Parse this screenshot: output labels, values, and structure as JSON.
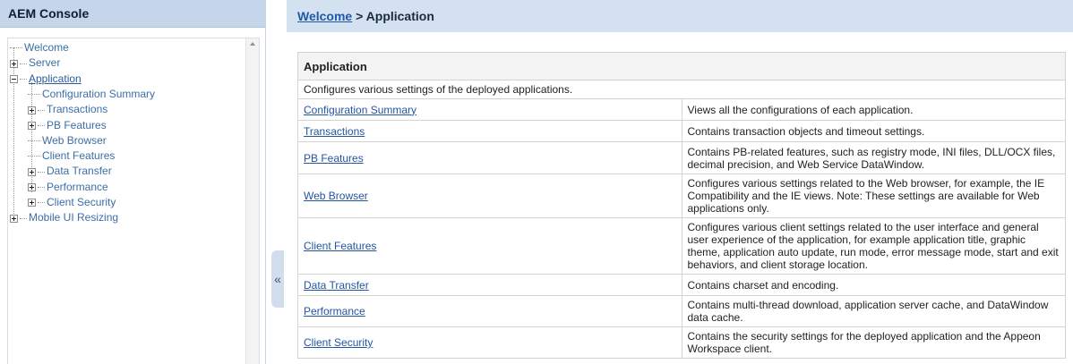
{
  "left_panel": {
    "title": "AEM Console",
    "tree": [
      {
        "label": "Welcome",
        "level": 0,
        "expander": "none",
        "is_link": false
      },
      {
        "label": "Server",
        "level": 0,
        "expander": "plus",
        "is_link": false
      },
      {
        "label": "Application",
        "level": 0,
        "expander": "minus",
        "is_link": true
      },
      {
        "label": "Configuration Summary",
        "level": 1,
        "expander": "none",
        "is_link": false
      },
      {
        "label": "Transactions",
        "level": 1,
        "expander": "plus",
        "is_link": false
      },
      {
        "label": "PB Features",
        "level": 1,
        "expander": "plus",
        "is_link": false
      },
      {
        "label": "Web Browser",
        "level": 1,
        "expander": "none",
        "is_link": false
      },
      {
        "label": "Client Features",
        "level": 1,
        "expander": "none",
        "is_link": false
      },
      {
        "label": "Data Transfer",
        "level": 1,
        "expander": "plus",
        "is_link": false
      },
      {
        "label": "Performance",
        "level": 1,
        "expander": "plus",
        "is_link": false
      },
      {
        "label": "Client Security",
        "level": 1,
        "expander": "plus",
        "is_link": false
      },
      {
        "label": "Mobile UI Resizing",
        "level": 0,
        "expander": "plus",
        "is_link": false
      }
    ]
  },
  "collapse_handle": {
    "glyph": "«"
  },
  "breadcrumb": {
    "link": "Welcome",
    "separator": ">",
    "current": "Application"
  },
  "table": {
    "header": "Application",
    "intro": "Configures various settings of the deployed applications.",
    "rows": [
      {
        "name": "Configuration Summary",
        "desc": "Views all the configurations of each application."
      },
      {
        "name": "Transactions",
        "desc": "Contains transaction objects and timeout settings."
      },
      {
        "name": "PB Features",
        "desc": "Contains PB-related features, such as registry mode, INI files, DLL/OCX files, decimal precision, and Web Service DataWindow."
      },
      {
        "name": "Web Browser",
        "desc": "Configures various settings related to the Web browser, for example, the IE Compatibility and the IE views. Note: These settings are available for Web applications only."
      },
      {
        "name": "Client Features",
        "desc": "Configures various client settings related to the user interface and general user experience of the application, for example application title, graphic theme, application auto update, run mode, error message mode, start and exit behaviors, and client storage location."
      },
      {
        "name": "Data Transfer",
        "desc": "Contains charset and encoding."
      },
      {
        "name": "Performance",
        "desc": "Contains multi-thread download, application server cache, and DataWindow data cache."
      },
      {
        "name": "Client Security",
        "desc": "Contains the security settings for the deployed application and the Appeon Workspace client."
      }
    ]
  }
}
